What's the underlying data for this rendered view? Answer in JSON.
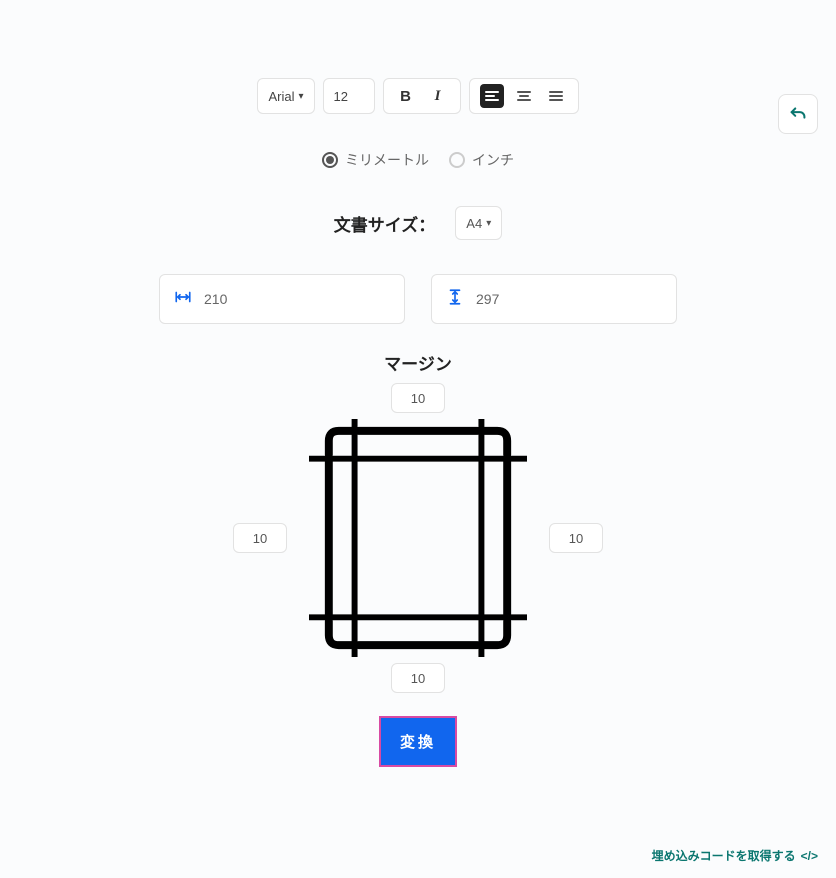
{
  "toolbar": {
    "font_family": "Arial",
    "font_size": "12"
  },
  "units": {
    "mm_label": "ミリメートル",
    "inch_label": "インチ",
    "selected": "mm"
  },
  "docsize": {
    "label": "文書サイズ：",
    "preset": "A4",
    "width": "210",
    "height": "297"
  },
  "margin": {
    "label": "マージン",
    "top": "10",
    "bottom": "10",
    "left": "10",
    "right": "10"
  },
  "convert_label": "変換",
  "embed_label": "埋め込みコードを取得する",
  "icons": {
    "undo": "undo-icon",
    "bold": "bold-icon",
    "italic": "italic-icon",
    "align_left": "align-left-icon",
    "align_center": "align-center-icon",
    "align_justify": "align-justify-icon",
    "width": "width-icon",
    "height": "height-icon",
    "embed_code": "code-icon"
  }
}
